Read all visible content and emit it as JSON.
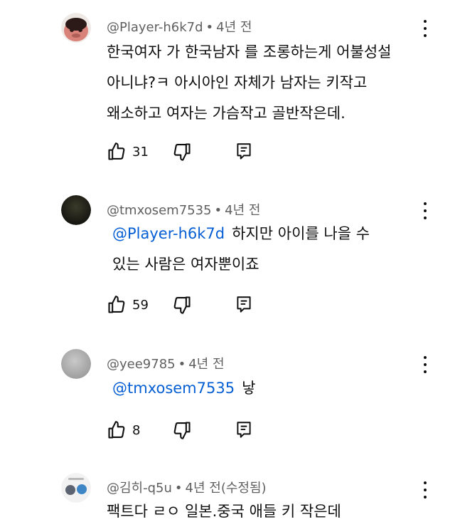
{
  "comments": [
    {
      "handle": "@Player-h6k7d",
      "time": "4년 전",
      "edited": "",
      "mention": "",
      "text": "한국여자 가 한국남자 를 조롱하는게 어불성설\n아니냐?ㅋ 아시아인 자체가 남자는 키작고\n왜소하고 여자는 가슴작고 골반작은데.",
      "likes": "31"
    },
    {
      "handle": "@tmxosem7535",
      "time": "4년 전",
      "edited": "",
      "mention": "@Player-h6k7d",
      "text": "하지만 아이를 나을 수\n있는 사람은 여자뿐이죠",
      "likes": "59"
    },
    {
      "handle": "@yee9785",
      "time": "4년 전",
      "edited": "",
      "mention": "@tmxosem7535",
      "text": "낳",
      "likes": "8"
    },
    {
      "handle": "@김히-q5u",
      "time": "4년 전",
      "edited": "(수정됨)",
      "mention": "",
      "text": "팩트다 ㄹㅇ 일본.중국 애들 키 작은데",
      "likes": ""
    }
  ],
  "icons": {
    "like": "thumbs-up-icon",
    "dislike": "thumbs-down-icon",
    "reply": "reply-icon",
    "more": "more-vertical-icon"
  },
  "colors": {
    "text": "#0f0f0f",
    "meta": "#606060",
    "mention": "#065fd4"
  }
}
